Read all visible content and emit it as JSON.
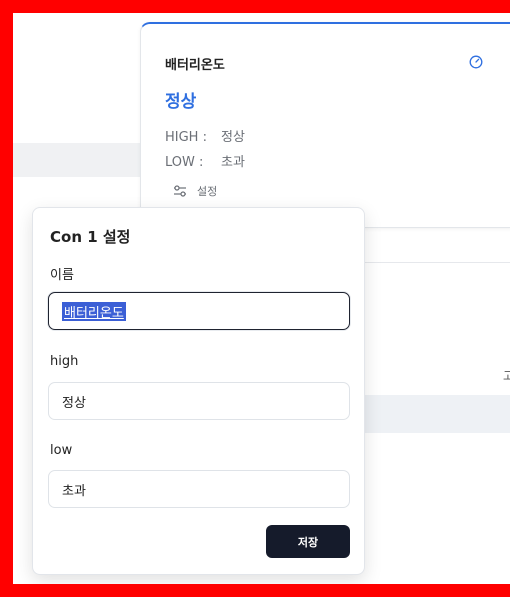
{
  "card": {
    "title": "배터리온도",
    "status": "정상",
    "high_label": "HIGH :",
    "high_value": "정상",
    "low_label": "LOW :",
    "low_value": "초과",
    "settings_label": "설정",
    "status_color": "#2f6fe0"
  },
  "background": {
    "cut_text": "고"
  },
  "popover": {
    "title": "Con 1 설정",
    "name_label": "이름",
    "name_value": "배터리온도",
    "high_label": "high",
    "high_value": "정상",
    "low_label": "low",
    "low_value": "초과",
    "save_label": "저장"
  },
  "colors": {
    "frame": "#ff0000",
    "accent": "#2f6fe0",
    "button": "#151b2b"
  }
}
